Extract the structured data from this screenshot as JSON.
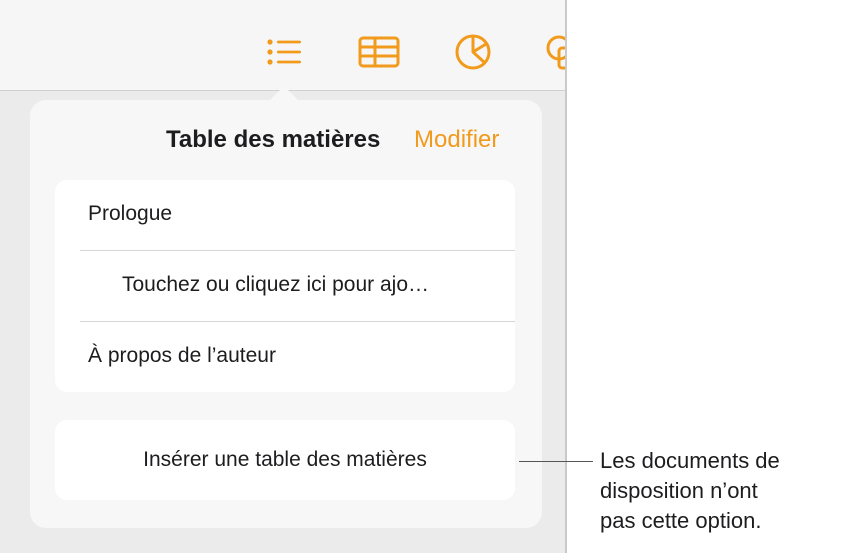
{
  "toolbar": {
    "icons": [
      "list-icon",
      "table-icon",
      "chart-icon",
      "shape-icon"
    ],
    "accent_color": "#f29a1b"
  },
  "popover": {
    "title": "Table des matières",
    "edit_label": "Modifier",
    "items": [
      {
        "label": "Prologue"
      },
      {
        "label": "Touchez ou cliquez ici pour ajo…"
      },
      {
        "label": "À propos de l’auteur"
      }
    ],
    "insert_label": "Insérer une table des matières"
  },
  "callout": {
    "lines": [
      "Les documents de",
      "disposition n’ont",
      "pas cette option."
    ]
  }
}
